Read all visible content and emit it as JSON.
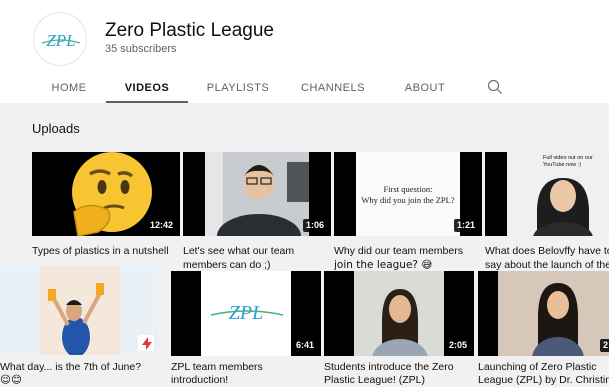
{
  "channel": {
    "name": "Zero Plastic League",
    "subscribers": "35 subscribers",
    "logo_text": "ZPL"
  },
  "tabs": {
    "home": "HOME",
    "videos": "VIDEOS",
    "playlists": "PLAYLISTS",
    "channels": "CHANNELS",
    "about": "ABOUT",
    "search_icon": "search-icon",
    "active": "VIDEOS"
  },
  "uploads_label": "Uploads",
  "videos": [
    {
      "title1": "Types of plastics in a nutshell",
      "title2": "",
      "duration": "12:42"
    },
    {
      "title1": "Let's see what our team",
      "title2": "members can do ;)",
      "duration": "1:06"
    },
    {
      "title1": "Why did our team members",
      "title2": "join the league? 😅",
      "duration": "1:21",
      "thumb_text1": "First question:",
      "thumb_text2": "Why did you join the ZPL?"
    },
    {
      "title1": "What does Belovffy have to",
      "title2": "say about the launch of the...",
      "duration": "",
      "thumb_text1": "Full video out on our",
      "thumb_text2": "YouTube now :)"
    },
    {
      "title1": "What day... is the 7th of June?",
      "title2": "😉😊",
      "duration": ""
    },
    {
      "title1": "ZPL team members",
      "title2": "introduction!",
      "duration": "6:41"
    },
    {
      "title1": "Students introduce the Zero",
      "title2": "Plastic League! (ZPL)",
      "duration": "2:05"
    },
    {
      "title1": "Launching of Zero Plastic",
      "title2": "League (ZPL) by Dr. Christin",
      "duration": "2"
    }
  ],
  "colors": {
    "background": "#f1f1f1",
    "header": "#ffffff",
    "badge": "#000000",
    "logo_blue": "#2a9fd6",
    "logo_green": "#3fb37f"
  }
}
